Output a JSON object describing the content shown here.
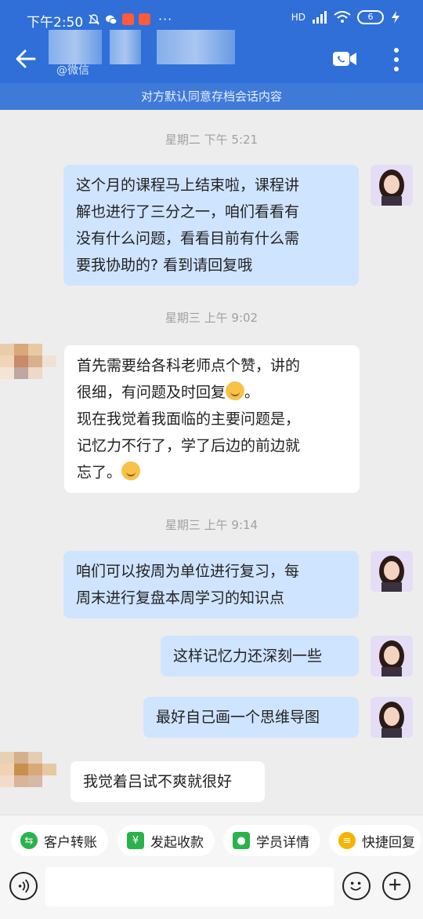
{
  "status_bar": {
    "time": "下午2:50",
    "battery": "6",
    "network": "HD"
  },
  "header": {
    "subname": "@微信"
  },
  "notice": "对方默认同意存档会话内容",
  "messages": [
    {
      "type": "timestamp",
      "text": "星期二  下午 5:21"
    },
    {
      "type": "me",
      "lines": [
        "这个月的课程马上结束啦，课程讲",
        "解也进行了三分之一，咱们看看有",
        "没有什么问题，看看目前有什么需",
        "要我协助的? 看到请回复哦"
      ]
    },
    {
      "type": "timestamp",
      "text": "星期三  上午 9:02"
    },
    {
      "type": "them",
      "lines": [
        "首先需要给各科老师点个赞，讲的",
        "很细，有问题及时回复",
        "。",
        "现在我觉着我面临的主要问题是，",
        "记忆力不行了，学了后边的前边就",
        "忘了。"
      ]
    },
    {
      "type": "timestamp",
      "text": "星期三  上午 9:14"
    },
    {
      "type": "me",
      "lines": [
        "咱们可以按周为单位进行复习，每",
        "周末进行复盘本周学习的知识点"
      ]
    },
    {
      "type": "me",
      "lines": [
        "这样记忆力还深刻一些"
      ]
    },
    {
      "type": "me",
      "lines": [
        "最好自己画一个思维导图"
      ]
    },
    {
      "type": "them",
      "lines": [
        "我觉着吕试不爽就很好"
      ]
    }
  ],
  "quick_actions": [
    {
      "label": "客户转账",
      "icon": "transfer-icon",
      "color": "#2bb24c"
    },
    {
      "label": "发起收款",
      "icon": "collect-payment-icon",
      "color": "#2bb24c"
    },
    {
      "label": "学员详情",
      "icon": "student-icon",
      "color": "#2bb24c"
    },
    {
      "label": "快捷回复",
      "icon": "quick-reply-icon",
      "color": "#f5b400"
    }
  ],
  "colors": {
    "header": "#2f6fd7",
    "bubble_me": "#cfe4ff",
    "bubble_them": "#ffffff"
  }
}
